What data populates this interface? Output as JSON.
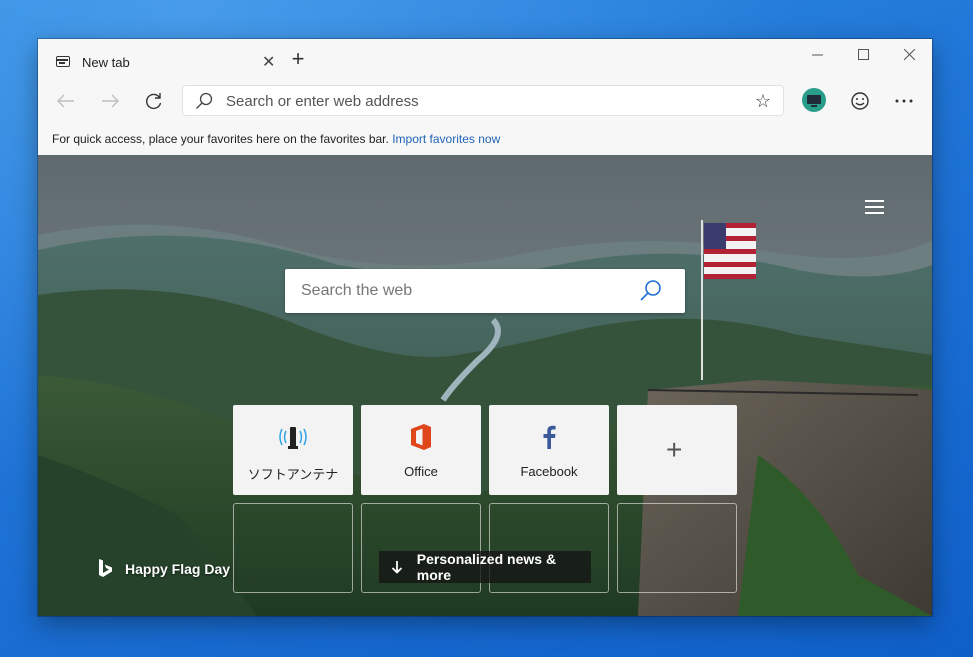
{
  "browser": {
    "tab": {
      "title": "New tab"
    },
    "address": {
      "placeholder": "Search or enter web address"
    },
    "favorites_bar": {
      "message": "For quick access, place your favorites here on the favorites bar.",
      "import_link": "Import favorites now"
    }
  },
  "new_tab_page": {
    "search": {
      "placeholder": "Search the web"
    },
    "tiles": [
      {
        "label": "ソフトアンテナ",
        "icon": "antenna-icon"
      },
      {
        "label": "Office",
        "icon": "office-icon"
      },
      {
        "label": "Facebook",
        "icon": "facebook-icon"
      },
      {
        "label": "",
        "icon": "plus-icon"
      }
    ],
    "background_caption": "Happy Flag Day",
    "news_button": "Personalized news & more"
  },
  "colors": {
    "desktop": "#1f74d6",
    "link": "#1f63b5",
    "office": "#e0461b",
    "facebook": "#3b5998",
    "avatar": "#2a9c8a"
  }
}
